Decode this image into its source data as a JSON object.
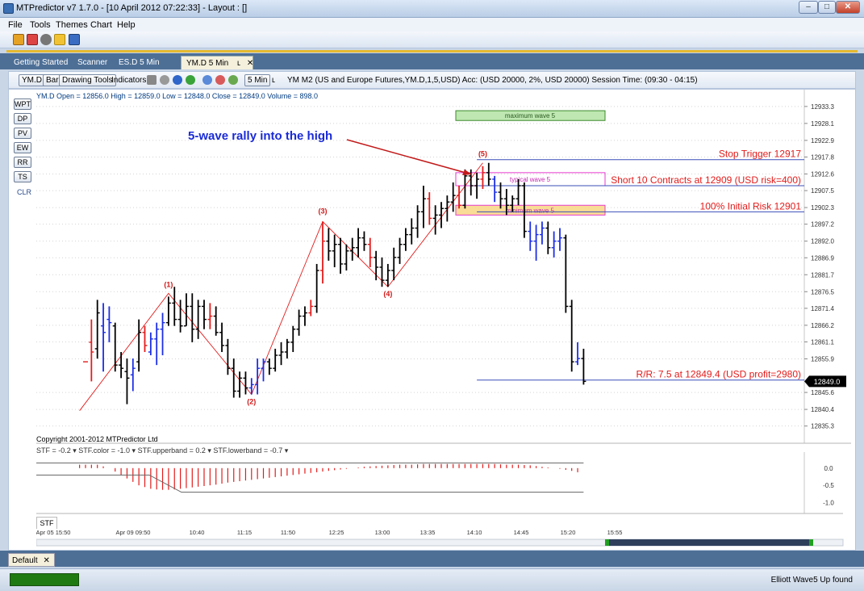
{
  "window": {
    "title": "MTPredictor v7 1.7.0 - [10 April 2012 07:22:33]  - Layout : []",
    "min_glyph": "–",
    "max_glyph": "□",
    "close_glyph": "✕"
  },
  "menu": [
    "File",
    "Tools",
    "Themes",
    "Chart",
    "Help"
  ],
  "tabs": [
    {
      "label": "Getting Started"
    },
    {
      "label": "Scanner"
    },
    {
      "label": "ES.D 5 Min"
    },
    {
      "label": "YM.D 5 Min",
      "active": true
    }
  ],
  "tab_pin_glyph": "ʟ",
  "tab_close_glyph": "✕",
  "chart_toolbar": {
    "symbol_button": "YM.D",
    "type_button": "Bar",
    "drawing_button": "Drawing Tools",
    "indicators_label": "Indicators",
    "interval_button": "5 Min",
    "lock_glyph": "ʟ",
    "description": "YM M2 (US and Europe Futures,YM.D,1,5,USD) Acc: (USD 20000, 2%, USD 20000) Session Time: (09:30 - 04:15)"
  },
  "side_buttons": [
    "WPT",
    "DP",
    "PV",
    "EW",
    "RR",
    "TS"
  ],
  "side_clr": "CLR",
  "ohlc_text": "YM.D Open = 12856.0  High = 12859.0  Low = 12848.0  Close = 12849.0  Volume = 898.0",
  "copyright": "Copyright 2001-2012 MTPredictor Ltd",
  "stf_legend": "STF = -0.2 ▾  STF.color = -1.0 ▾  STF.upperband = 0.2 ▾  STF.lowerband = -0.7 ▾",
  "stf_tab": "STF",
  "annotations": {
    "headline": "5-wave rally into the high",
    "stop_trigger": "Stop Trigger 12917",
    "short_entry": "Short 10 Contracts at 12909 (USD risk=400)",
    "initial_risk": "100% Initial Risk 12901",
    "rr_line": "R/R: 7.5 at 12849.4 (USD profit=2980)",
    "last_price": "12849.0",
    "box_max": "maximum wave 5",
    "box_typ": "typical wave 5",
    "box_min": "minimum wave 5"
  },
  "wave_labels": [
    "(1)",
    "(2)",
    "(3)",
    "(4)",
    "(5)"
  ],
  "colors": {
    "up_bar": "#000000",
    "down_bar": "#e31b1b",
    "blue_bar": "#1c2ee6",
    "annotation_red": "#e31b1b",
    "headline_blue": "#1a2bd6",
    "level_line": "#3a4fb8",
    "max_box": "#b7e4a8",
    "typ_box_border": "#e63ad0",
    "min_box": "#f8d88a"
  },
  "chart_data": {
    "type": "bar",
    "ylim": [
      12832,
      12935
    ],
    "y_ticks": [
      12933.3,
      12928.1,
      12922.9,
      12917.8,
      12912.6,
      12907.5,
      12902.3,
      12897.2,
      12892.0,
      12886.9,
      12881.7,
      12876.5,
      12871.4,
      12866.2,
      12861.1,
      12855.9,
      12845.6,
      12840.4,
      12835.3
    ],
    "x_ticks": [
      "Apr 05 15:50",
      "Apr 09 09:50",
      "10:40",
      "11:15",
      "11:50",
      "12:25",
      "13:00",
      "13:35",
      "14:10",
      "14:45",
      "15:20",
      "15:55"
    ],
    "bars": [
      {
        "o": 12855,
        "h": 12855,
        "l": 12855,
        "c": 12855,
        "col": "r"
      },
      {
        "o": 12861,
        "h": 12868,
        "l": 12849,
        "c": 12858,
        "col": "r"
      },
      {
        "o": 12859,
        "h": 12874,
        "l": 12856,
        "c": 12870,
        "col": "k"
      },
      {
        "o": 12866,
        "h": 12873,
        "l": 12852,
        "c": 12864,
        "col": "b"
      },
      {
        "o": 12868,
        "h": 12872,
        "l": 12861,
        "c": 12867,
        "col": "b"
      },
      {
        "o": 12866,
        "h": 12867,
        "l": 12852,
        "c": 12854,
        "col": "k"
      },
      {
        "o": 12854,
        "h": 12858,
        "l": 12850,
        "c": 12853,
        "col": "k"
      },
      {
        "o": 12852,
        "h": 12856,
        "l": 12842,
        "c": 12850,
        "col": "k"
      },
      {
        "o": 12851,
        "h": 12856,
        "l": 12846,
        "c": 12853,
        "col": "b"
      },
      {
        "o": 12855,
        "h": 12868,
        "l": 12852,
        "c": 12864,
        "col": "k"
      },
      {
        "o": 12864,
        "h": 12866,
        "l": 12858,
        "c": 12860,
        "col": "r"
      },
      {
        "o": 12858,
        "h": 12864,
        "l": 12857,
        "c": 12862,
        "col": "b"
      },
      {
        "o": 12862,
        "h": 12867,
        "l": 12854,
        "c": 12865,
        "col": "b"
      },
      {
        "o": 12865,
        "h": 12870,
        "l": 12857,
        "c": 12867,
        "col": "b"
      },
      {
        "o": 12867,
        "h": 12875,
        "l": 12866,
        "c": 12873,
        "col": "k"
      },
      {
        "o": 12873,
        "h": 12878,
        "l": 12866,
        "c": 12868,
        "col": "k"
      },
      {
        "o": 12868,
        "h": 12874,
        "l": 12864,
        "c": 12866,
        "col": "k"
      },
      {
        "o": 12866,
        "h": 12876,
        "l": 12866,
        "c": 12872,
        "col": "k"
      },
      {
        "o": 12872,
        "h": 12876,
        "l": 12861,
        "c": 12865,
        "col": "k"
      },
      {
        "o": 12865,
        "h": 12874,
        "l": 12862,
        "c": 12872,
        "col": "k"
      },
      {
        "o": 12872,
        "h": 12874,
        "l": 12865,
        "c": 12868,
        "col": "k"
      },
      {
        "o": 12868,
        "h": 12873,
        "l": 12865,
        "c": 12869,
        "col": "r"
      },
      {
        "o": 12869,
        "h": 12872,
        "l": 12863,
        "c": 12864,
        "col": "k"
      },
      {
        "o": 12864,
        "h": 12867,
        "l": 12858,
        "c": 12860,
        "col": "k"
      },
      {
        "o": 12860,
        "h": 12862,
        "l": 12851,
        "c": 12853,
        "col": "k"
      },
      {
        "o": 12853,
        "h": 12856,
        "l": 12844,
        "c": 12846,
        "col": "k"
      },
      {
        "o": 12846,
        "h": 12852,
        "l": 12844,
        "c": 12850,
        "col": "k"
      },
      {
        "o": 12850,
        "h": 12852,
        "l": 12845,
        "c": 12847,
        "col": "k"
      },
      {
        "o": 12847,
        "h": 12850,
        "l": 12845,
        "c": 12848,
        "col": "b"
      },
      {
        "o": 12848,
        "h": 12856,
        "l": 12845,
        "c": 12853,
        "col": "b"
      },
      {
        "o": 12853,
        "h": 12856,
        "l": 12849,
        "c": 12855,
        "col": "b"
      },
      {
        "o": 12855,
        "h": 12856,
        "l": 12851,
        "c": 12853,
        "col": "k"
      },
      {
        "o": 12853,
        "h": 12859,
        "l": 12852,
        "c": 12857,
        "col": "k"
      },
      {
        "o": 12857,
        "h": 12861,
        "l": 12854,
        "c": 12858,
        "col": "k"
      },
      {
        "o": 12858,
        "h": 12862,
        "l": 12856,
        "c": 12861,
        "col": "k"
      },
      {
        "o": 12861,
        "h": 12866,
        "l": 12858,
        "c": 12865,
        "col": "k"
      },
      {
        "o": 12865,
        "h": 12871,
        "l": 12863,
        "c": 12869,
        "col": "k"
      },
      {
        "o": 12869,
        "h": 12872,
        "l": 12866,
        "c": 12870,
        "col": "k"
      },
      {
        "o": 12870,
        "h": 12874,
        "l": 12869,
        "c": 12872,
        "col": "r"
      },
      {
        "o": 12872,
        "h": 12885,
        "l": 12870,
        "c": 12883,
        "col": "k"
      },
      {
        "o": 12883,
        "h": 12898,
        "l": 12879,
        "c": 12892,
        "col": "r"
      },
      {
        "o": 12892,
        "h": 12896,
        "l": 12886,
        "c": 12889,
        "col": "k"
      },
      {
        "o": 12889,
        "h": 12894,
        "l": 12884,
        "c": 12891,
        "col": "k"
      },
      {
        "o": 12891,
        "h": 12893,
        "l": 12882,
        "c": 12885,
        "col": "k"
      },
      {
        "o": 12885,
        "h": 12891,
        "l": 12883,
        "c": 12889,
        "col": "k"
      },
      {
        "o": 12889,
        "h": 12893,
        "l": 12886,
        "c": 12890,
        "col": "k"
      },
      {
        "o": 12890,
        "h": 12896,
        "l": 12887,
        "c": 12893,
        "col": "k"
      },
      {
        "o": 12893,
        "h": 12895,
        "l": 12889,
        "c": 12891,
        "col": "k"
      },
      {
        "o": 12891,
        "h": 12893,
        "l": 12884,
        "c": 12887,
        "col": "r"
      },
      {
        "o": 12887,
        "h": 12889,
        "l": 12880,
        "c": 12884,
        "col": "k"
      },
      {
        "o": 12884,
        "h": 12887,
        "l": 12878,
        "c": 12880,
        "col": "k"
      },
      {
        "o": 12880,
        "h": 12885,
        "l": 12878,
        "c": 12883,
        "col": "k"
      },
      {
        "o": 12883,
        "h": 12890,
        "l": 12880,
        "c": 12887,
        "col": "k"
      },
      {
        "o": 12887,
        "h": 12893,
        "l": 12885,
        "c": 12891,
        "col": "k"
      },
      {
        "o": 12891,
        "h": 12896,
        "l": 12889,
        "c": 12894,
        "col": "k"
      },
      {
        "o": 12894,
        "h": 12899,
        "l": 12891,
        "c": 12896,
        "col": "k"
      },
      {
        "o": 12896,
        "h": 12903,
        "l": 12893,
        "c": 12901,
        "col": "k"
      },
      {
        "o": 12901,
        "h": 12909,
        "l": 12896,
        "c": 12905,
        "col": "k"
      },
      {
        "o": 12905,
        "h": 12907,
        "l": 12897,
        "c": 12899,
        "col": "r"
      },
      {
        "o": 12899,
        "h": 12903,
        "l": 12894,
        "c": 12900,
        "col": "k"
      },
      {
        "o": 12900,
        "h": 12904,
        "l": 12896,
        "c": 12902,
        "col": "k"
      },
      {
        "o": 12902,
        "h": 12906,
        "l": 12898,
        "c": 12904,
        "col": "k"
      },
      {
        "o": 12904,
        "h": 12910,
        "l": 12901,
        "c": 12906,
        "col": "k"
      },
      {
        "o": 12906,
        "h": 12909,
        "l": 12902,
        "c": 12903,
        "col": "r"
      },
      {
        "o": 12903,
        "h": 12914,
        "l": 12902,
        "c": 12912,
        "col": "k"
      },
      {
        "o": 12912,
        "h": 12914,
        "l": 12906,
        "c": 12909,
        "col": "k"
      },
      {
        "o": 12909,
        "h": 12913,
        "l": 12905,
        "c": 12911,
        "col": "k"
      },
      {
        "o": 12911,
        "h": 12915,
        "l": 12908,
        "c": 12913,
        "col": "r"
      },
      {
        "o": 12913,
        "h": 12916,
        "l": 12909,
        "c": 12911,
        "col": "k"
      },
      {
        "o": 12911,
        "h": 12912,
        "l": 12904,
        "c": 12907,
        "col": "b"
      },
      {
        "o": 12907,
        "h": 12910,
        "l": 12902,
        "c": 12905,
        "col": "k"
      },
      {
        "o": 12905,
        "h": 12908,
        "l": 12900,
        "c": 12903,
        "col": "k"
      },
      {
        "o": 12903,
        "h": 12906,
        "l": 12901,
        "c": 12905,
        "col": "k"
      },
      {
        "o": 12905,
        "h": 12911,
        "l": 12903,
        "c": 12909,
        "col": "k"
      },
      {
        "o": 12909,
        "h": 12910,
        "l": 12893,
        "c": 12895,
        "col": "k"
      },
      {
        "o": 12895,
        "h": 12898,
        "l": 12889,
        "c": 12892,
        "col": "b"
      },
      {
        "o": 12892,
        "h": 12897,
        "l": 12886,
        "c": 12894,
        "col": "b"
      },
      {
        "o": 12894,
        "h": 12898,
        "l": 12891,
        "c": 12896,
        "col": "b"
      },
      {
        "o": 12896,
        "h": 12898,
        "l": 12888,
        "c": 12890,
        "col": "k"
      },
      {
        "o": 12890,
        "h": 12895,
        "l": 12887,
        "c": 12892,
        "col": "b"
      },
      {
        "o": 12892,
        "h": 12896,
        "l": 12889,
        "c": 12893,
        "col": "b"
      },
      {
        "o": 12893,
        "h": 12894,
        "l": 12870,
        "c": 12872,
        "col": "k"
      },
      {
        "o": 12872,
        "h": 12874,
        "l": 12852,
        "c": 12855,
        "col": "k"
      },
      {
        "o": 12855,
        "h": 12861,
        "l": 12854,
        "c": 12856,
        "col": "b"
      },
      {
        "o": 12856,
        "h": 12859,
        "l": 12848,
        "c": 12849,
        "col": "k"
      }
    ],
    "wave_points": [
      {
        "label": "(1)",
        "bar": -1,
        "price": 12840
      },
      {
        "label": "(1)",
        "bar": 14,
        "price": 12876
      },
      {
        "label": "(2)",
        "bar": 28,
        "price": 12845
      },
      {
        "label": "(3)",
        "bar": 40,
        "price": 12898
      },
      {
        "label": "(4)",
        "bar": 51,
        "price": 12878
      },
      {
        "label": "(5)",
        "bar": 67,
        "price": 12916
      }
    ],
    "levels": [
      {
        "price": 12917,
        "text": "Stop Trigger 12917",
        "from_bar": 66
      },
      {
        "price": 12909,
        "text": "Short 10 Contracts at 12909 (USD risk=400)",
        "from_bar": 66
      },
      {
        "price": 12901,
        "text": "100% Initial Risk 12901",
        "from_bar": 66
      },
      {
        "price": 12849.4,
        "text": "R/R: 7.5 at 12849.4 (USD profit=2980)",
        "from_bar": 66
      }
    ],
    "boxes": [
      {
        "name": "maximum wave 5",
        "top": 12932,
        "bottom": 12929
      },
      {
        "name": "typical wave 5",
        "top": 12913,
        "bottom": 12909
      },
      {
        "name": "minimum wave 5",
        "top": 12903,
        "bottom": 12900
      }
    ],
    "stf": {
      "ylim": [
        -1.2,
        0.3
      ],
      "y_ticks": [
        0.0,
        -0.5,
        -1.0
      ],
      "upperband": 0.2,
      "lowerband": -0.7,
      "values": [
        0.1,
        0.1,
        0.1,
        0.1,
        0.05,
        0,
        -0.1,
        -0.2,
        -0.3,
        -0.4,
        -0.5,
        -0.55,
        -0.6,
        -0.62,
        -0.63,
        -0.63,
        -0.62,
        -0.6,
        -0.58,
        -0.56,
        -0.54,
        -0.52,
        -0.5,
        -0.48,
        -0.45,
        -0.42,
        -0.4,
        -0.38,
        -0.36,
        -0.34,
        -0.32,
        -0.3,
        -0.28,
        -0.26,
        -0.24,
        -0.22,
        -0.2,
        -0.18,
        -0.16,
        -0.14,
        -0.12,
        -0.1,
        -0.08,
        -0.06,
        -0.04,
        -0.02,
        0,
        0.02,
        0.04,
        0.05,
        0.06,
        0.07,
        0.08,
        0.09,
        0.1,
        0.1,
        0.1,
        0.11,
        0.12,
        0.12,
        0.12,
        0.12,
        0.12,
        0.12,
        0.12,
        0.12,
        0.12,
        0.12,
        0.12,
        0.12,
        0.12,
        0.11,
        0.1,
        0.1,
        0.1,
        0.09,
        0.08,
        0.06,
        0.04,
        0.02,
        0,
        -0.02,
        -0.05,
        -0.08,
        -0.12
      ]
    }
  },
  "doc_tab": "Default",
  "status_text": "Elliott Wave5 Up found"
}
